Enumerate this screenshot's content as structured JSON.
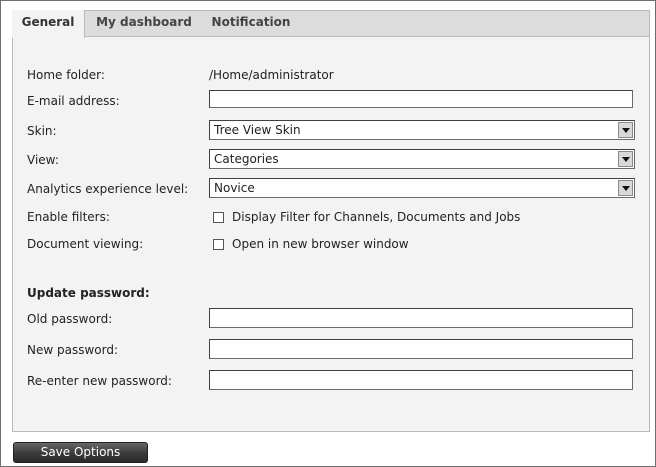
{
  "tabs": [
    {
      "label": "General",
      "active": true
    },
    {
      "label": "My dashboard",
      "active": false
    },
    {
      "label": "Notification",
      "active": false
    }
  ],
  "form": {
    "home_folder_label": "Home folder:",
    "home_folder_value": "/Home/administrator",
    "email_label": "E-mail address:",
    "email_value": "",
    "skin_label": "Skin:",
    "skin_value": "Tree View Skin",
    "view_label": "View:",
    "view_value": "Categories",
    "analytics_label": "Analytics experience level:",
    "analytics_value": "Novice",
    "filters_label": "Enable filters:",
    "filters_option": "Display Filter for Channels, Documents and Jobs",
    "filters_checked": false,
    "doc_view_label": "Document viewing:",
    "doc_view_option": "Open in new browser window",
    "doc_view_checked": false
  },
  "password": {
    "section_title": "Update password:",
    "old_label": "Old password:",
    "new_label": "New password:",
    "reenter_label": "Re-enter new password:"
  },
  "actions": {
    "save_label": "Save Options"
  }
}
